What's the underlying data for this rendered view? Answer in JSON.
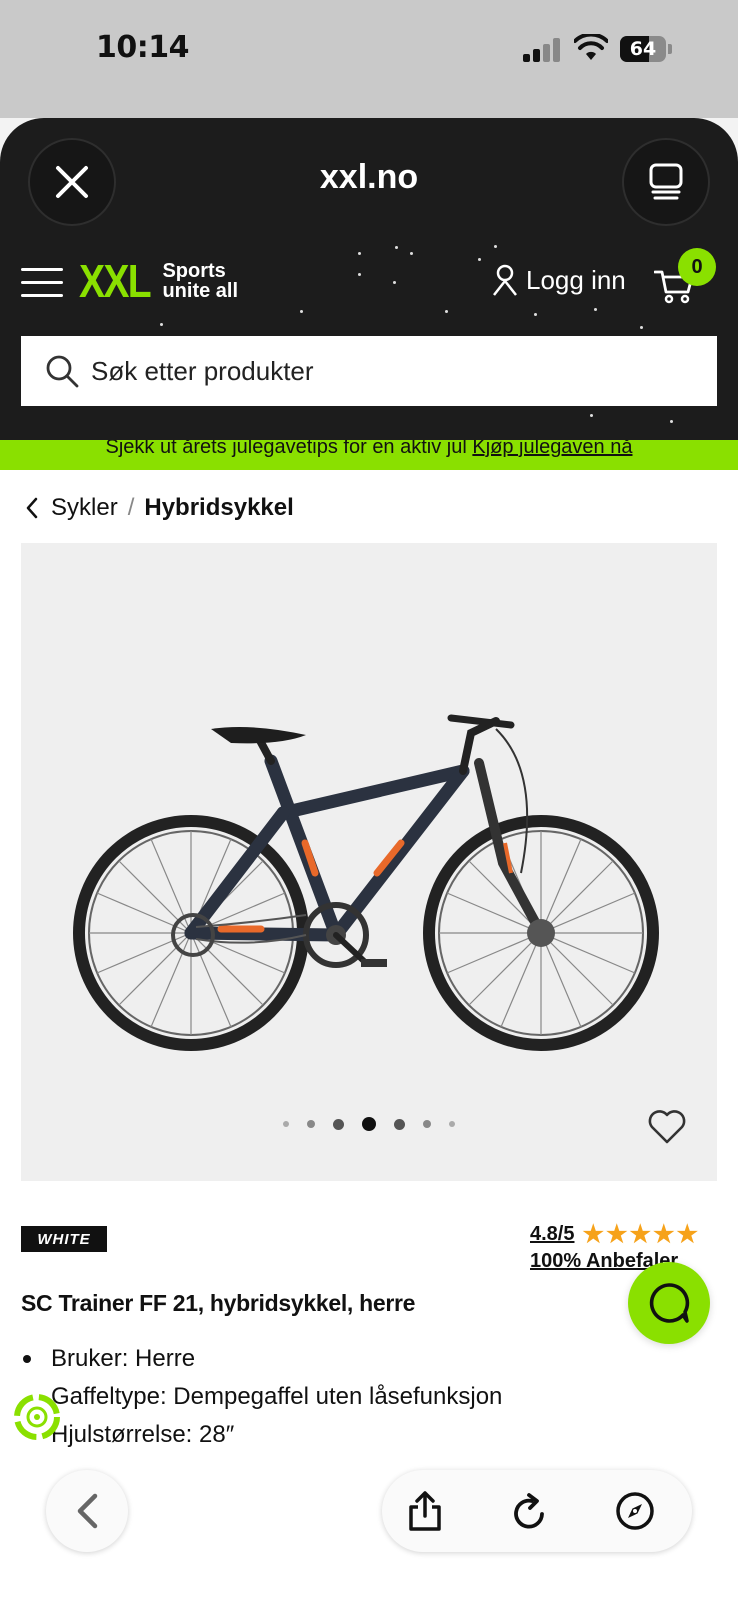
{
  "status_bar": {
    "time": "10:14",
    "battery_percent": "64",
    "battery_level": 0.64
  },
  "browser": {
    "site_title": "xxl.no",
    "close_icon": "close-icon",
    "tabs_icon": "tabs-icon"
  },
  "header": {
    "logo_text": "XXL",
    "logo_tagline_1": "Sports",
    "logo_tagline_2": "unite all",
    "login_label": "Logg inn",
    "cart_count": "0",
    "search_placeholder": "Søk etter produkter"
  },
  "promo": {
    "text": "Sjekk ut årets julegavetips for en aktiv jul",
    "link": "Kjøp julegaven nå"
  },
  "breadcrumb": {
    "parent": "Sykler",
    "separator": "/",
    "current": "Hybridsykkel"
  },
  "gallery": {
    "image_count": 7,
    "active_index": 3
  },
  "product": {
    "brand": "WHITE",
    "rating": "4.8/5",
    "stars": 5,
    "recommend": "100% Anbefaler",
    "title": "SC Trainer FF 21, hybridsykkel, herre",
    "specs": [
      "Bruker: Herre",
      "Gaffeltype: Dempegaffel uten låsefunksjon",
      "Hjulstørrelse: 28″"
    ]
  },
  "colors": {
    "brand_green": "#8ae000",
    "header_dark": "#1c1c1c",
    "star_orange": "#f6a21a"
  },
  "bottom_bar": {
    "back_icon": "chevron-left-icon",
    "share_icon": "share-icon",
    "reload_icon": "reload-icon",
    "compass_icon": "compass-icon"
  }
}
